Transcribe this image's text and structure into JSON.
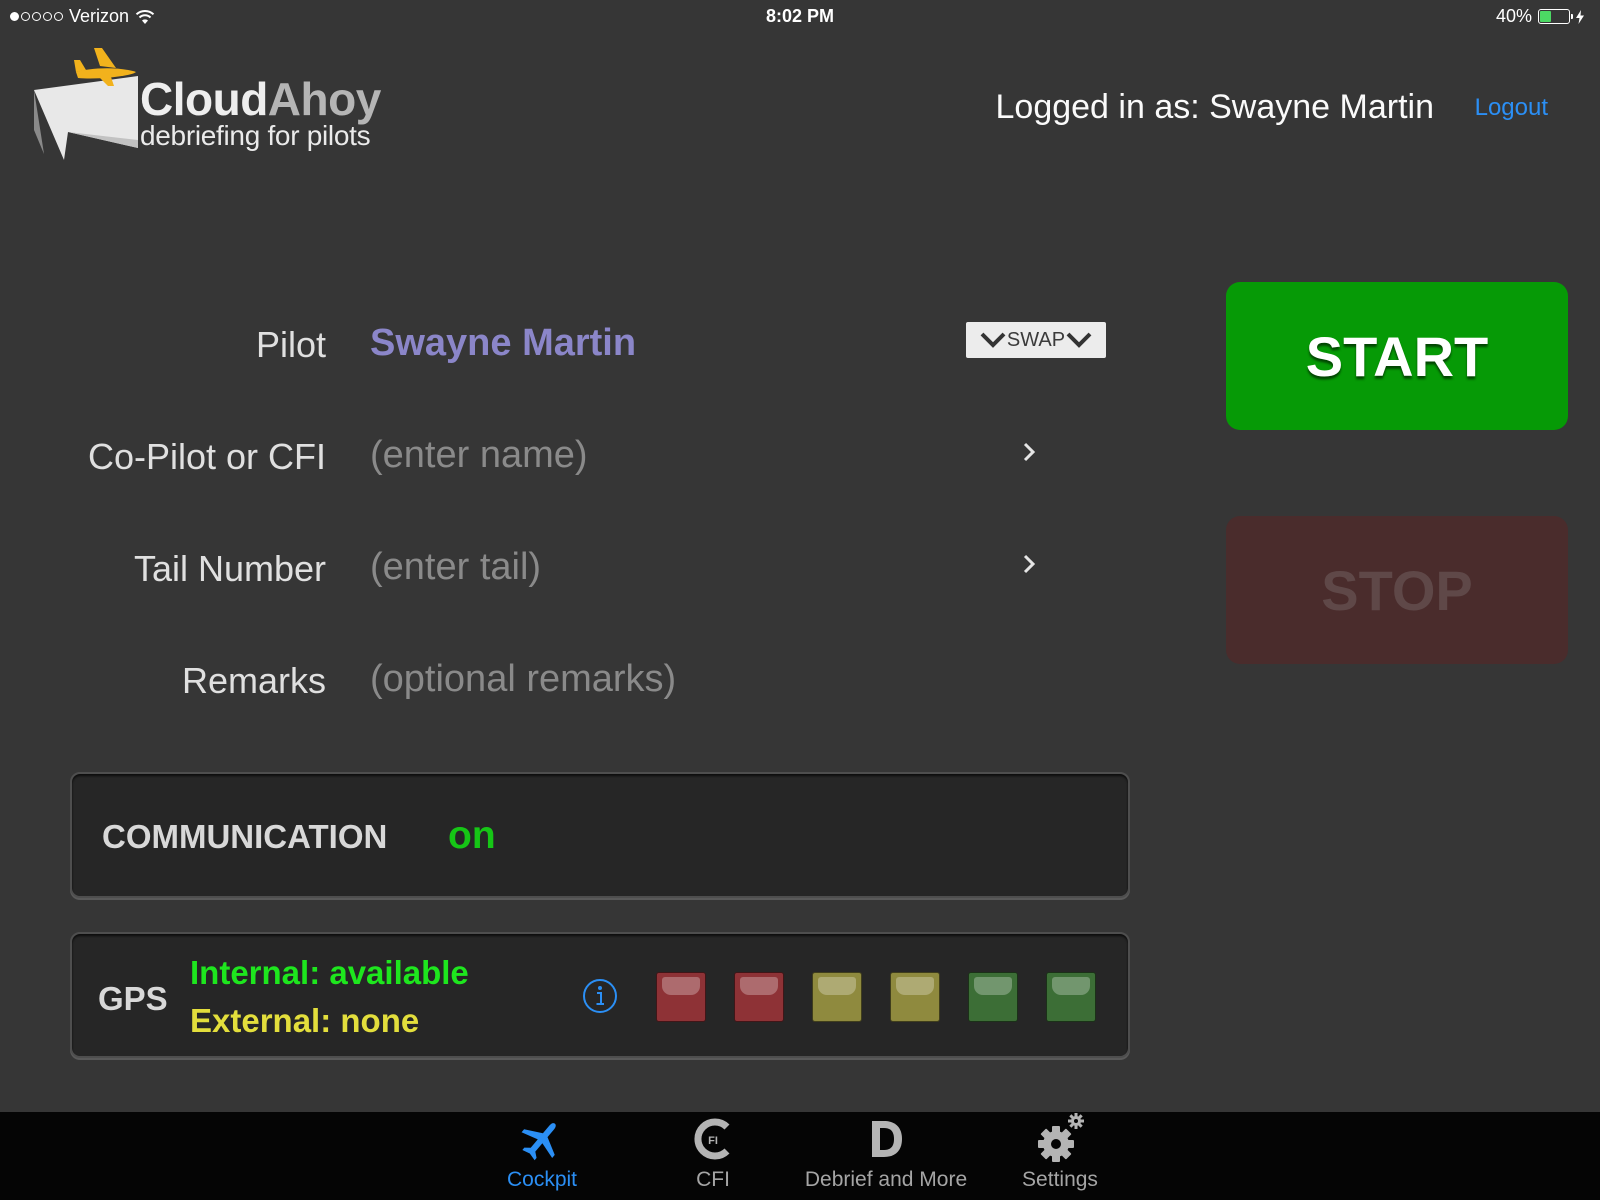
{
  "status_bar": {
    "signal_dots": [
      true,
      false,
      false,
      false,
      false
    ],
    "carrier": "Verizon",
    "time": "8:02 PM",
    "battery_percent": "40%",
    "battery_level": 0.4
  },
  "header": {
    "logo_title_part1": "Cloud",
    "logo_title_part2": "Ahoy",
    "logo_subtitle": "debriefing for pilots",
    "login_text": "Logged in as: Swayne Martin",
    "logout_label": "Logout"
  },
  "form": {
    "pilot_label": "Pilot",
    "pilot_value": "Swayne Martin",
    "swap_label": "SWAP",
    "copilot_label": "Co-Pilot or CFI",
    "copilot_placeholder": "(enter name)",
    "tail_label": "Tail Number",
    "tail_placeholder": "(enter tail)",
    "remarks_label": "Remarks",
    "remarks_placeholder": "(optional remarks)"
  },
  "controls": {
    "start_label": "START",
    "stop_label": "STOP"
  },
  "communication": {
    "label": "COMMUNICATION",
    "status": "on"
  },
  "gps": {
    "label": "GPS",
    "internal": "Internal: available",
    "external": "External: none",
    "signal_indicators": [
      "red",
      "red",
      "yellow",
      "yellow",
      "green",
      "green"
    ]
  },
  "tabbar": {
    "tabs": [
      {
        "label": "Cockpit",
        "icon": "airplane-icon",
        "active": true
      },
      {
        "label": "CFI",
        "icon": "cfi-icon",
        "active": false
      },
      {
        "label": "Debrief and More",
        "icon": "debrief-icon",
        "active": false
      },
      {
        "label": "Settings",
        "icon": "gear-icon",
        "active": false
      }
    ]
  },
  "colors": {
    "background": "#363636",
    "accent_blue": "#2b8ff5",
    "start_green": "#069a06",
    "stop_red_disabled": "#4a2c2c",
    "pilot_name": "#8b86c9",
    "status_on_green": "#16c616",
    "gps_internal_green": "#1ee61e",
    "gps_external_yellow": "#e3de3c",
    "logo_plane_yellow": "#f2b21c"
  }
}
